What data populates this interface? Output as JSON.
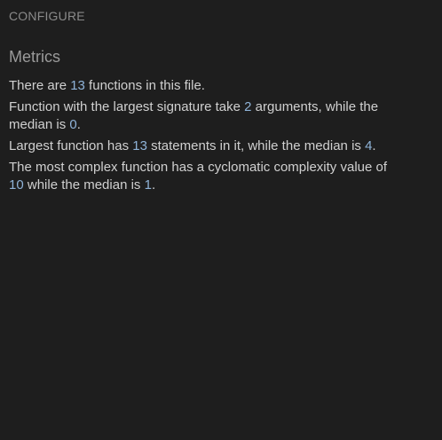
{
  "header": {
    "configure_label": "CONFIGURE"
  },
  "metrics": {
    "title": "Metrics",
    "line1": {
      "pre": "There are ",
      "n": "13",
      "post": " functions in this file."
    },
    "line2": {
      "pre": "Function with the largest signature take ",
      "n1": "2",
      "mid": " arguments, while the median is ",
      "n2": "0",
      "post": "."
    },
    "line3": {
      "pre": "Largest function has ",
      "n1": "13",
      "mid": " statements in it, while the median is ",
      "n2": "4",
      "post": "."
    },
    "line4": {
      "pre": "The most complex function has a cyclomatic complexity value of ",
      "n1": "10",
      "mid": " while the median is ",
      "n2": "1",
      "post": "."
    }
  },
  "colors": {
    "background": "#1e1e1e",
    "text": "#d0d0d0",
    "muted": "#8a8a8a",
    "number_accent": "#8fb3d8"
  }
}
